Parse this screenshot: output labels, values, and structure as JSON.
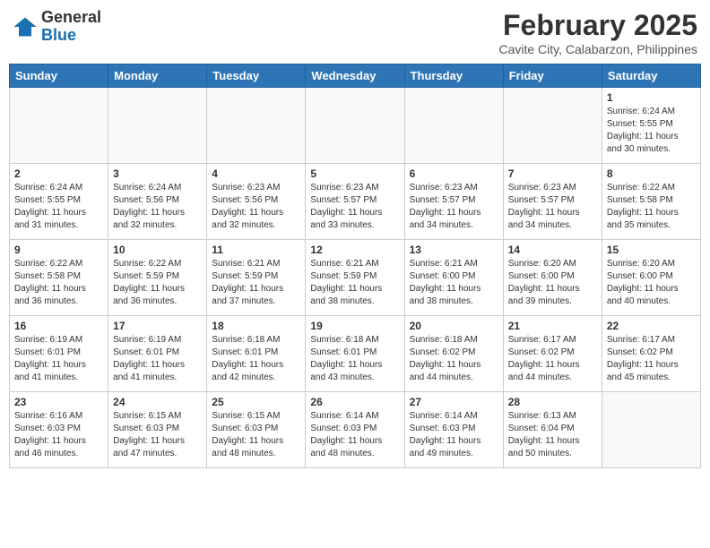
{
  "header": {
    "logo_general": "General",
    "logo_blue": "Blue",
    "month_year": "February 2025",
    "location": "Cavite City, Calabarzon, Philippines"
  },
  "weekdays": [
    "Sunday",
    "Monday",
    "Tuesday",
    "Wednesday",
    "Thursday",
    "Friday",
    "Saturday"
  ],
  "weeks": [
    [
      {
        "day": "",
        "info": ""
      },
      {
        "day": "",
        "info": ""
      },
      {
        "day": "",
        "info": ""
      },
      {
        "day": "",
        "info": ""
      },
      {
        "day": "",
        "info": ""
      },
      {
        "day": "",
        "info": ""
      },
      {
        "day": "1",
        "info": "Sunrise: 6:24 AM\nSunset: 5:55 PM\nDaylight: 11 hours\nand 30 minutes."
      }
    ],
    [
      {
        "day": "2",
        "info": "Sunrise: 6:24 AM\nSunset: 5:55 PM\nDaylight: 11 hours\nand 31 minutes."
      },
      {
        "day": "3",
        "info": "Sunrise: 6:24 AM\nSunset: 5:56 PM\nDaylight: 11 hours\nand 32 minutes."
      },
      {
        "day": "4",
        "info": "Sunrise: 6:23 AM\nSunset: 5:56 PM\nDaylight: 11 hours\nand 32 minutes."
      },
      {
        "day": "5",
        "info": "Sunrise: 6:23 AM\nSunset: 5:57 PM\nDaylight: 11 hours\nand 33 minutes."
      },
      {
        "day": "6",
        "info": "Sunrise: 6:23 AM\nSunset: 5:57 PM\nDaylight: 11 hours\nand 34 minutes."
      },
      {
        "day": "7",
        "info": "Sunrise: 6:23 AM\nSunset: 5:57 PM\nDaylight: 11 hours\nand 34 minutes."
      },
      {
        "day": "8",
        "info": "Sunrise: 6:22 AM\nSunset: 5:58 PM\nDaylight: 11 hours\nand 35 minutes."
      }
    ],
    [
      {
        "day": "9",
        "info": "Sunrise: 6:22 AM\nSunset: 5:58 PM\nDaylight: 11 hours\nand 36 minutes."
      },
      {
        "day": "10",
        "info": "Sunrise: 6:22 AM\nSunset: 5:59 PM\nDaylight: 11 hours\nand 36 minutes."
      },
      {
        "day": "11",
        "info": "Sunrise: 6:21 AM\nSunset: 5:59 PM\nDaylight: 11 hours\nand 37 minutes."
      },
      {
        "day": "12",
        "info": "Sunrise: 6:21 AM\nSunset: 5:59 PM\nDaylight: 11 hours\nand 38 minutes."
      },
      {
        "day": "13",
        "info": "Sunrise: 6:21 AM\nSunset: 6:00 PM\nDaylight: 11 hours\nand 38 minutes."
      },
      {
        "day": "14",
        "info": "Sunrise: 6:20 AM\nSunset: 6:00 PM\nDaylight: 11 hours\nand 39 minutes."
      },
      {
        "day": "15",
        "info": "Sunrise: 6:20 AM\nSunset: 6:00 PM\nDaylight: 11 hours\nand 40 minutes."
      }
    ],
    [
      {
        "day": "16",
        "info": "Sunrise: 6:19 AM\nSunset: 6:01 PM\nDaylight: 11 hours\nand 41 minutes."
      },
      {
        "day": "17",
        "info": "Sunrise: 6:19 AM\nSunset: 6:01 PM\nDaylight: 11 hours\nand 41 minutes."
      },
      {
        "day": "18",
        "info": "Sunrise: 6:18 AM\nSunset: 6:01 PM\nDaylight: 11 hours\nand 42 minutes."
      },
      {
        "day": "19",
        "info": "Sunrise: 6:18 AM\nSunset: 6:01 PM\nDaylight: 11 hours\nand 43 minutes."
      },
      {
        "day": "20",
        "info": "Sunrise: 6:18 AM\nSunset: 6:02 PM\nDaylight: 11 hours\nand 44 minutes."
      },
      {
        "day": "21",
        "info": "Sunrise: 6:17 AM\nSunset: 6:02 PM\nDaylight: 11 hours\nand 44 minutes."
      },
      {
        "day": "22",
        "info": "Sunrise: 6:17 AM\nSunset: 6:02 PM\nDaylight: 11 hours\nand 45 minutes."
      }
    ],
    [
      {
        "day": "23",
        "info": "Sunrise: 6:16 AM\nSunset: 6:03 PM\nDaylight: 11 hours\nand 46 minutes."
      },
      {
        "day": "24",
        "info": "Sunrise: 6:15 AM\nSunset: 6:03 PM\nDaylight: 11 hours\nand 47 minutes."
      },
      {
        "day": "25",
        "info": "Sunrise: 6:15 AM\nSunset: 6:03 PM\nDaylight: 11 hours\nand 48 minutes."
      },
      {
        "day": "26",
        "info": "Sunrise: 6:14 AM\nSunset: 6:03 PM\nDaylight: 11 hours\nand 48 minutes."
      },
      {
        "day": "27",
        "info": "Sunrise: 6:14 AM\nSunset: 6:03 PM\nDaylight: 11 hours\nand 49 minutes."
      },
      {
        "day": "28",
        "info": "Sunrise: 6:13 AM\nSunset: 6:04 PM\nDaylight: 11 hours\nand 50 minutes."
      },
      {
        "day": "",
        "info": ""
      }
    ]
  ]
}
